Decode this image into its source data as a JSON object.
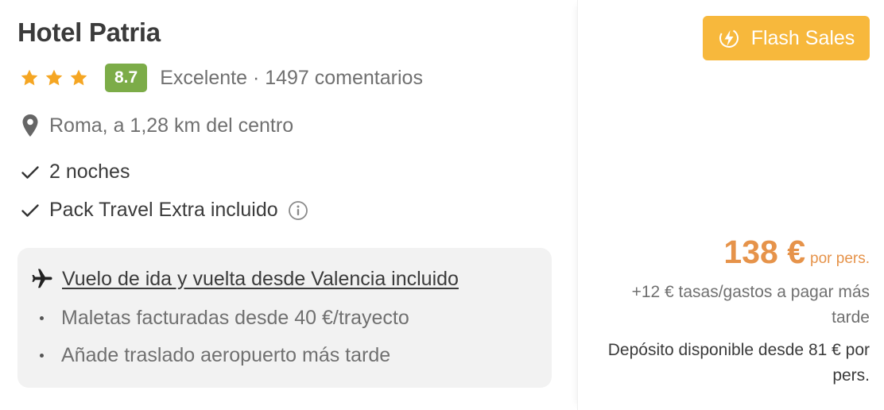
{
  "hotel": {
    "name": "Hotel Patria",
    "star_count": 3,
    "score": "8.7",
    "rating_summary": "Excelente · 1497 comentarios",
    "location": "Roma, a 1,28 km del centro"
  },
  "features": [
    {
      "label": "2 noches"
    },
    {
      "label": "Pack Travel Extra incluido"
    }
  ],
  "flight": {
    "title": "Vuelo de ida y vuelta desde Valencia incluido",
    "details": [
      "Maletas facturadas desde 40 €/trayecto",
      "Añade traslado aeropuerto más tarde"
    ]
  },
  "offer": {
    "badge": "Flash Sales",
    "price": "138 €",
    "per_person": "por pers.",
    "taxes": "+12 € tasas/gastos a pagar más tarde",
    "deposit": "Depósito disponible desde 81 € por pers."
  },
  "colors": {
    "star": "#f5a623",
    "score_bg": "#7cac48",
    "badge_bg": "#f7b83c",
    "price": "#e6934a"
  }
}
